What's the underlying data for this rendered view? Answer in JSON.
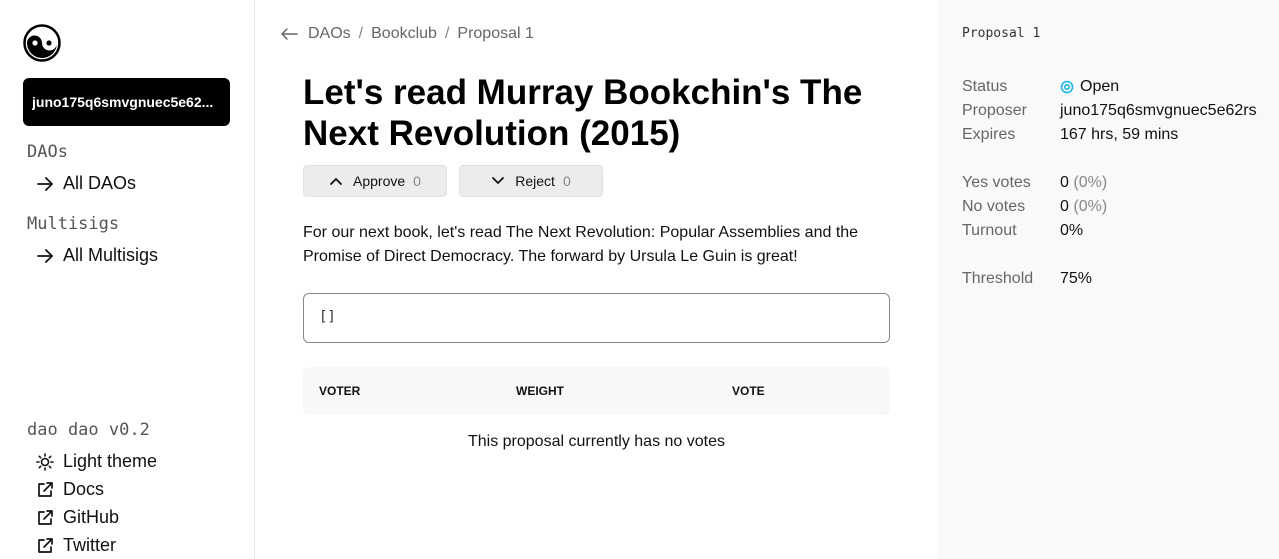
{
  "sidebar": {
    "wallet_address": "juno175q6smvgnuec5e62...",
    "daos_heading": "DAOs",
    "all_daos": "All DAOs",
    "multisigs_heading": "Multisigs",
    "all_multisigs": "All Multisigs",
    "version": "dao dao v0.2",
    "links": [
      {
        "label": "Light theme",
        "icon": "sun-icon"
      },
      {
        "label": "Docs",
        "icon": "external-link-icon"
      },
      {
        "label": "GitHub",
        "icon": "external-link-icon"
      },
      {
        "label": "Twitter",
        "icon": "external-link-icon"
      }
    ]
  },
  "breadcrumb": [
    "DAOs",
    "Bookclub",
    "Proposal 1"
  ],
  "proposal": {
    "title": "Let's read Murray Bookchin's The Next Revolution (2015)",
    "approve_label": "Approve",
    "approve_count": "0",
    "reject_label": "Reject",
    "reject_count": "0",
    "description": "For our next book, let's read The Next Revolution: Popular Assemblies and the Promise of Direct Democracy. The forward by Ursula Le Guin is great!",
    "messages_json": "[]"
  },
  "votes_table": {
    "columns": [
      "VOTER",
      "WEIGHT",
      "VOTE"
    ],
    "empty_text": "This proposal currently has no votes"
  },
  "details": {
    "heading": "Proposal 1",
    "status_label": "Status",
    "status_value": "Open",
    "proposer_label": "Proposer",
    "proposer_value": "juno175q6smvgnuec5e62rs",
    "expires_label": "Expires",
    "expires_value": "167 hrs, 59 mins",
    "yes_label": "Yes votes",
    "yes_value": "0",
    "yes_pct": "(0%)",
    "no_label": "No votes",
    "no_value": "0",
    "no_pct": "(0%)",
    "turnout_label": "Turnout",
    "turnout_value": "0%",
    "threshold_label": "Threshold",
    "threshold_value": "75%"
  },
  "colors": {
    "status_open": "#1fb6e5",
    "wallet_bg": "#000000"
  }
}
